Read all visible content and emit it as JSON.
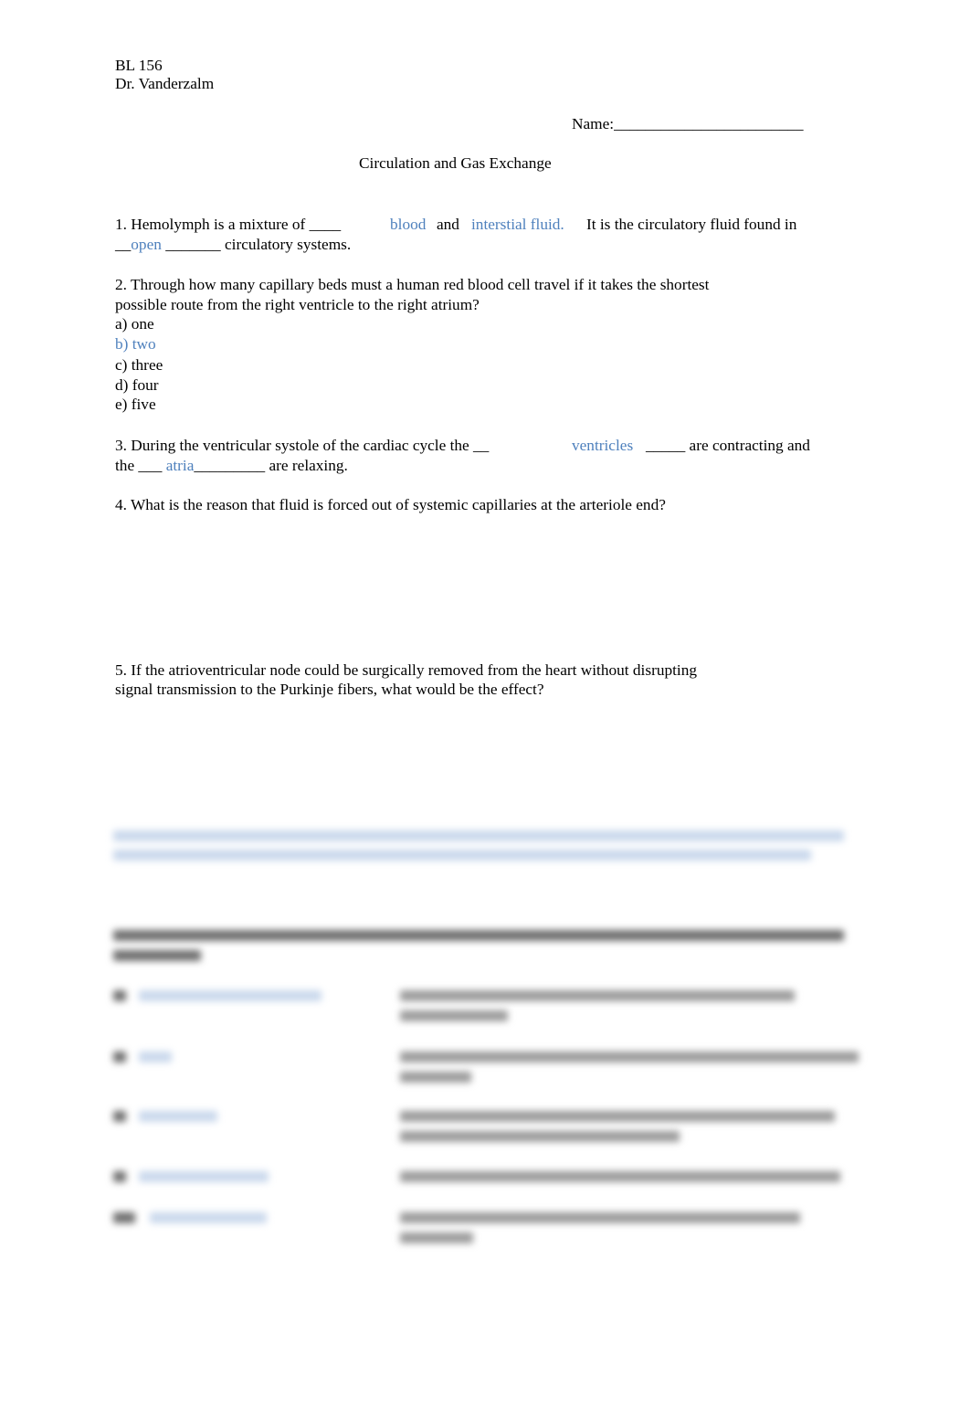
{
  "header": {
    "course": "BL 156",
    "instructor": "Dr. Vanderzalm",
    "name_label": "Name:",
    "name_blank": "________________________",
    "title": "Circulation and Gas Exchange"
  },
  "colors": {
    "answer": "#4f81bd",
    "text": "#000000"
  },
  "questions": {
    "q1": {
      "line1_a": "1.  Hemolymph is a mixture of ____",
      "ans1": "blood",
      "and": "and",
      "ans2": "interstial fluid.",
      "line1_b": "It is the circulatory fluid found in",
      "line2_a": "__",
      "ans3": "open",
      "line2_b": " _______ circulatory systems."
    },
    "q2": {
      "line1": "2.  Through how many capillary beds must a human red blood cell travel if it takes the shortest",
      "line2": "possible route from the right ventricle to the right atrium?",
      "options": [
        "a) one",
        "b) two",
        "c) three",
        "d) four",
        "e) five"
      ],
      "answer_index": 1
    },
    "q3": {
      "line1_a": "3.  During the ventricular systole of the cardiac cycle the __",
      "ans1": "ventricles",
      "line1_b": "_____ are contracting and",
      "line2_a": "the ___ ",
      "ans2": "atria",
      "line2_b": "_________ are relaxing."
    },
    "q4": {
      "text": "4.  What is the reason that fluid is forced out of systemic capillaries at the arteriole end?"
    },
    "q5": {
      "line1": "5.  If the atrioventricular node could be surgically removed from the heart without disrupting",
      "line2": "signal transmission to the Purkinje fibers, what would be the effect?"
    }
  },
  "obscured_section": {
    "note": "Remaining content is blurred and illegible"
  }
}
